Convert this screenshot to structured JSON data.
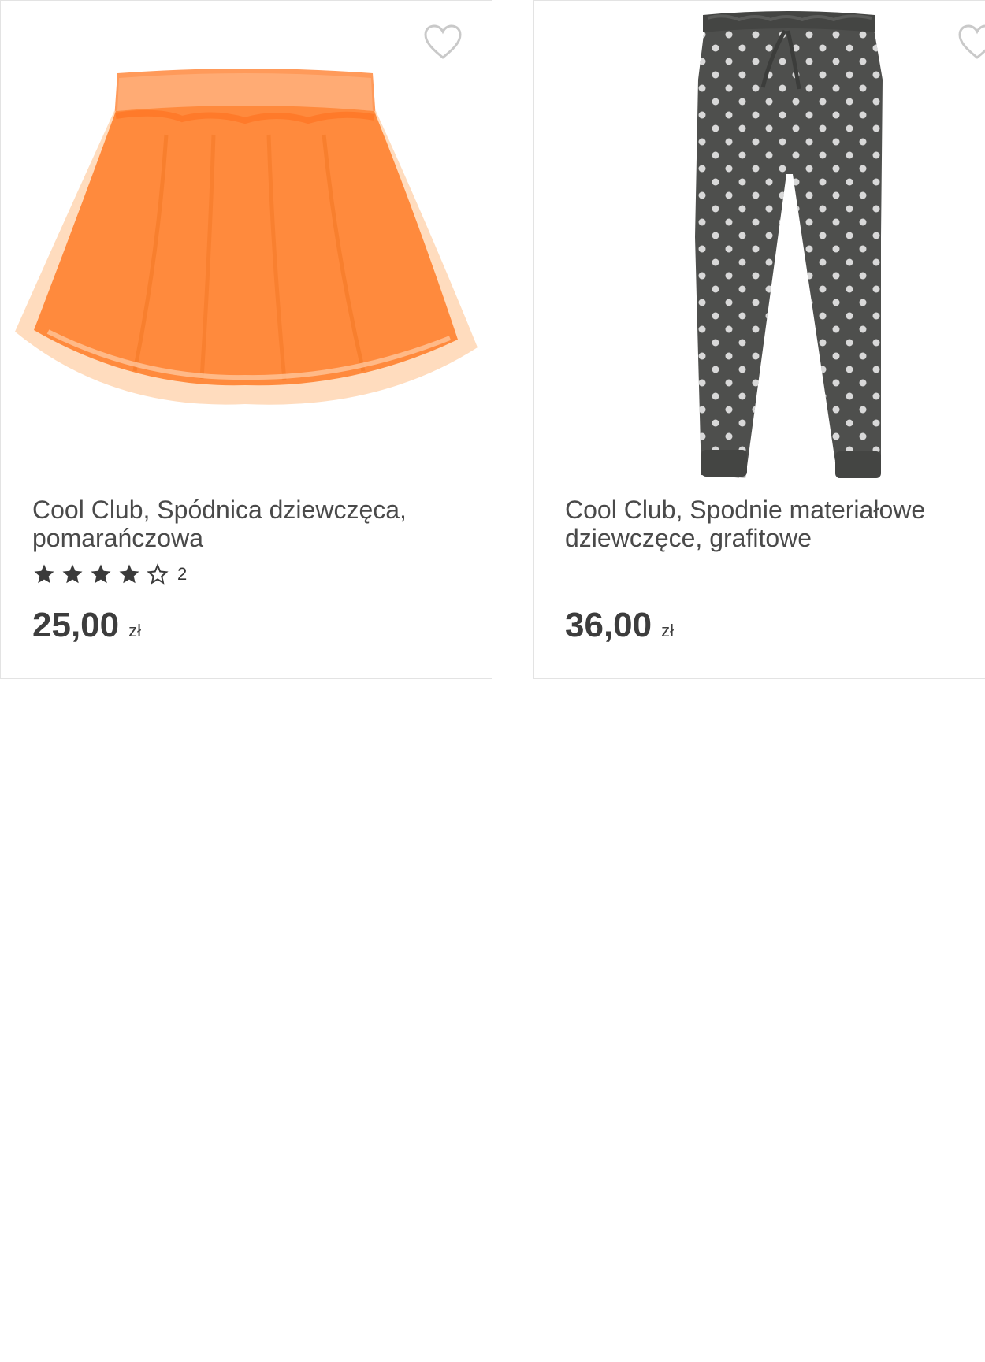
{
  "products": [
    {
      "title_line1": "Cool Club, Spódnica dziewczęca,",
      "title_line2": "pomarańczowa",
      "rating": 4,
      "rating_max": 5,
      "rating_count": "2",
      "price": "25,00",
      "currency": "zł",
      "image_icon": "orange-tulle-skirt",
      "favorite_icon": "heart-outline-icon"
    },
    {
      "title_line1": "Cool Club, Spodnie materiałowe",
      "title_line2": "dziewczęce, grafitowe",
      "price": "36,00",
      "currency": "zł",
      "image_icon": "graphite-polka-dot-trousers",
      "favorite_icon": "heart-outline-icon"
    }
  ],
  "colors": {
    "text": "#4a4a4a",
    "price": "#3d3d3d",
    "border": "#e3e3e3",
    "star": "#3a3a3a",
    "skirt": "#ff8a3d",
    "trousers": "#4e4f4d"
  }
}
